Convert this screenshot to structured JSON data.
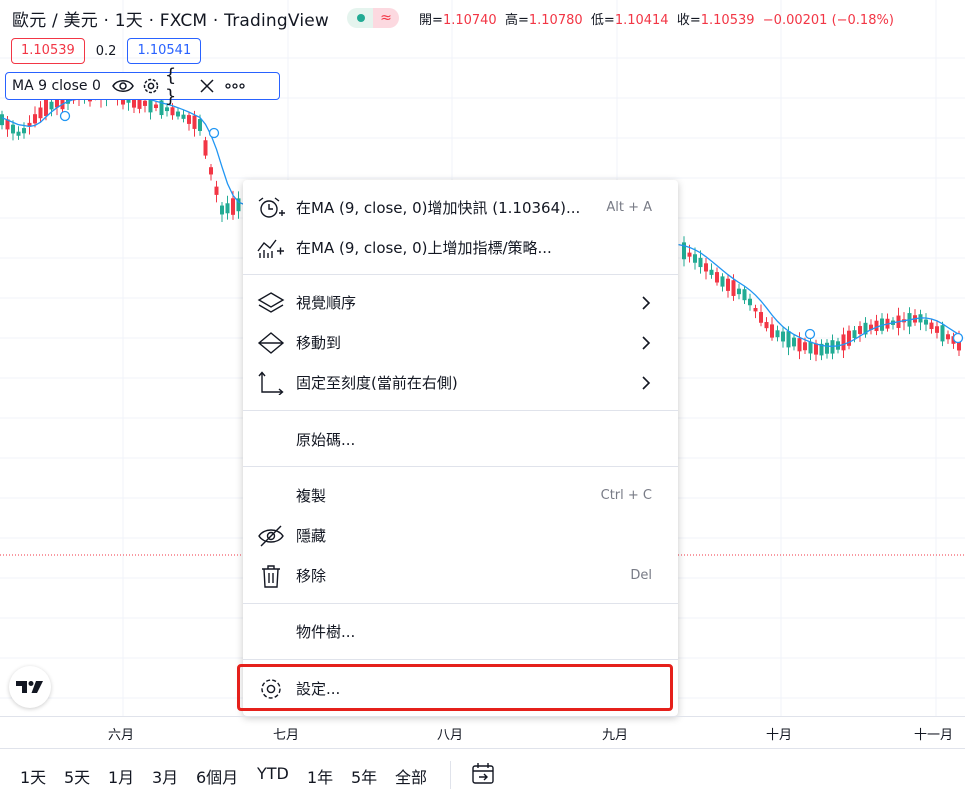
{
  "header": {
    "symbol_title": "歐元 / 美元 · 1天 · FXCM · TradingView",
    "ohlc": {
      "open_label": "開=",
      "open_value": "1.10740",
      "high_label": "高=",
      "high_value": "1.10780",
      "low_label": "低=",
      "low_value": "1.10414",
      "close_label": "收=",
      "close_value": "1.10539",
      "change": "−0.00201 (−0.18%)"
    },
    "bid": "1.10539",
    "spread": "0.2",
    "ask": "1.10541",
    "market_status_icon": "wave-icon"
  },
  "indicator_legend": {
    "title": "MA 9 close 0",
    "icons": [
      "eye-icon",
      "gear-icon",
      "braces-icon",
      "close-icon",
      "more-icon"
    ]
  },
  "context_menu": {
    "items": [
      {
        "label": "在MA (9, close, 0)增加快訊 (1.10364)...",
        "shortcut": "Alt + A",
        "icon": "alarm-add-icon"
      },
      {
        "label": "在MA (9, close, 0)上增加指標/策略...",
        "icon": "indicator-add-icon"
      },
      {
        "label": "視覺順序",
        "icon": "layers-icon",
        "submenu": true
      },
      {
        "label": "移動到",
        "icon": "move-icon",
        "submenu": true
      },
      {
        "label": "固定至刻度(當前在右側)",
        "icon": "scale-pin-icon",
        "submenu": true
      },
      {
        "label": "原始碼..."
      },
      {
        "label": "複製",
        "shortcut": "Ctrl + C"
      },
      {
        "label": "隱藏",
        "icon": "eye-off-icon"
      },
      {
        "label": "移除",
        "shortcut": "Del",
        "icon": "trash-icon"
      },
      {
        "label": "物件樹..."
      },
      {
        "label": "設定...",
        "icon": "gear-icon"
      }
    ]
  },
  "time_axis": [
    "六月",
    "七月",
    "八月",
    "九月",
    "十月",
    "十一月"
  ],
  "range_buttons": [
    "1天",
    "5天",
    "1月",
    "3月",
    "6個月",
    "YTD",
    "1年",
    "5年",
    "全部"
  ],
  "colors": {
    "up": "#22ab94",
    "down": "#f23645",
    "ma_line": "#2196f3",
    "highlight": "#e5201b"
  }
}
